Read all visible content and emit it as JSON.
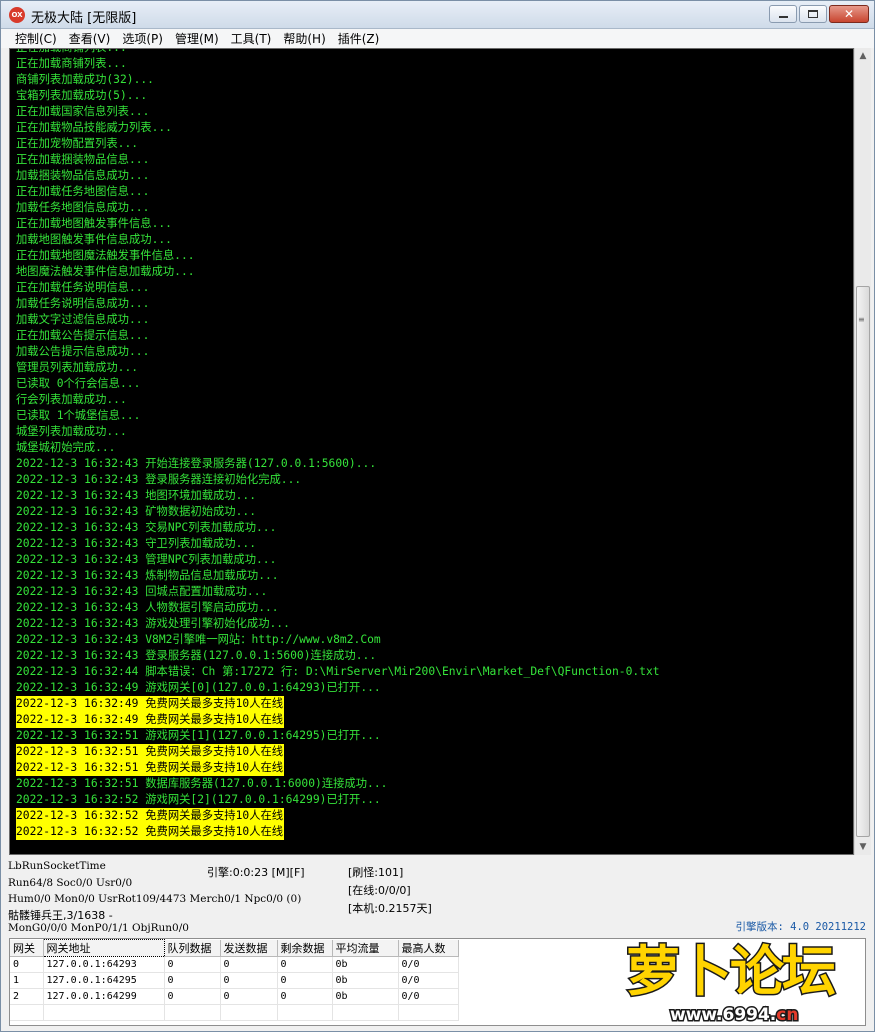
{
  "window": {
    "icon_text": "OX",
    "title": "无极大陆 [无限版]"
  },
  "menu": [
    "控制(C)",
    "查看(V)",
    "选项(P)",
    "管理(M)",
    "工具(T)",
    "帮助(H)",
    "插件(Z)"
  ],
  "colors": {
    "console_bg": "#000000",
    "log_text": "#35e33a",
    "highlight_bg": "#ffff00",
    "highlight_text": "#000000",
    "version_text": "#1b5aa6"
  },
  "log": [
    {
      "text": "正在加载商铺列表...",
      "highlight": false
    },
    {
      "text": "正在加载商铺列表...",
      "highlight": false
    },
    {
      "text": "商铺列表加载成功(32)...",
      "highlight": false
    },
    {
      "text": "宝箱列表加载成功(5)...",
      "highlight": false
    },
    {
      "text": "正在加载国家信息列表...",
      "highlight": false
    },
    {
      "text": "正在加载物品技能威力列表...",
      "highlight": false
    },
    {
      "text": "正在加宠物配置列表...",
      "highlight": false
    },
    {
      "text": "正在加载捆装物品信息...",
      "highlight": false
    },
    {
      "text": "加载捆装物品信息成功...",
      "highlight": false
    },
    {
      "text": "正在加载任务地图信息...",
      "highlight": false
    },
    {
      "text": "加载任务地图信息成功...",
      "highlight": false
    },
    {
      "text": "正在加载地图触发事件信息...",
      "highlight": false
    },
    {
      "text": "加载地图触发事件信息成功...",
      "highlight": false
    },
    {
      "text": "正在加载地图魔法触发事件信息...",
      "highlight": false
    },
    {
      "text": "地图魔法触发事件信息加载成功...",
      "highlight": false
    },
    {
      "text": "正在加载任务说明信息...",
      "highlight": false
    },
    {
      "text": "加载任务说明信息成功...",
      "highlight": false
    },
    {
      "text": "加载文字过滤信息成功...",
      "highlight": false
    },
    {
      "text": "正在加载公告提示信息...",
      "highlight": false
    },
    {
      "text": "加载公告提示信息成功...",
      "highlight": false
    },
    {
      "text": "管理员列表加载成功...",
      "highlight": false
    },
    {
      "text": "已读取 0个行会信息...",
      "highlight": false
    },
    {
      "text": "行会列表加载成功...",
      "highlight": false
    },
    {
      "text": "已读取 1个城堡信息...",
      "highlight": false
    },
    {
      "text": "城堡列表加载成功...",
      "highlight": false
    },
    {
      "text": "城堡城初始完成...",
      "highlight": false
    },
    {
      "text": "2022-12-3 16:32:43 开始连接登录服务器(127.0.0.1:5600)...",
      "highlight": false
    },
    {
      "text": "2022-12-3 16:32:43 登录服务器连接初始化完成...",
      "highlight": false
    },
    {
      "text": "2022-12-3 16:32:43 地图环境加载成功...",
      "highlight": false
    },
    {
      "text": "2022-12-3 16:32:43 矿物数据初始成功...",
      "highlight": false
    },
    {
      "text": "2022-12-3 16:32:43 交易NPC列表加载成功...",
      "highlight": false
    },
    {
      "text": "2022-12-3 16:32:43 守卫列表加载成功...",
      "highlight": false
    },
    {
      "text": "2022-12-3 16:32:43 管理NPC列表加载成功...",
      "highlight": false
    },
    {
      "text": "2022-12-3 16:32:43 炼制物品信息加载成功...",
      "highlight": false
    },
    {
      "text": "2022-12-3 16:32:43 回城点配置加载成功...",
      "highlight": false
    },
    {
      "text": "2022-12-3 16:32:43 人物数据引擎启动成功...",
      "highlight": false
    },
    {
      "text": "2022-12-3 16:32:43 游戏处理引擎初始化成功...",
      "highlight": false
    },
    {
      "text": "2022-12-3 16:32:43 V8M2引擎唯一网站：http://www.v8m2.Com",
      "highlight": false
    },
    {
      "text": "2022-12-3 16:32:43 登录服务器(127.0.0.1:5600)连接成功...",
      "highlight": false
    },
    {
      "text": "2022-12-3 16:32:44 脚本错误：Ch 第:17272 行: D:\\MirServer\\Mir200\\Envir\\Market_Def\\QFunction-0.txt",
      "highlight": false
    },
    {
      "text": "2022-12-3 16:32:49 游戏网关[0](127.0.0.1:64293)已打开...",
      "highlight": false
    },
    {
      "text": "2022-12-3 16:32:49 免费网关最多支持10人在线",
      "highlight": true
    },
    {
      "text": "2022-12-3 16:32:49 免费网关最多支持10人在线",
      "highlight": true
    },
    {
      "text": "2022-12-3 16:32:51 游戏网关[1](127.0.0.1:64295)已打开...",
      "highlight": false
    },
    {
      "text": "2022-12-3 16:32:51 免费网关最多支持10人在线",
      "highlight": true
    },
    {
      "text": "2022-12-3 16:32:51 免费网关最多支持10人在线",
      "highlight": true
    },
    {
      "text": "2022-12-3 16:32:51 数据库服务器(127.0.0.1:6000)连接成功...",
      "highlight": false
    },
    {
      "text": "2022-12-3 16:32:52 游戏网关[2](127.0.0.1:64299)已打开...",
      "highlight": false
    },
    {
      "text": "2022-12-3 16:32:52 免费网关最多支持10人在线",
      "highlight": true
    },
    {
      "text": "2022-12-3 16:32:52 免费网关最多支持10人在线",
      "highlight": true
    }
  ],
  "status": {
    "socket_time": "LbRunSocketTime",
    "run": "Run64/8 Soc0/0 Usr0/0",
    "hum": "Hum0/0 Mon0/0 UsrRot109/4473 Merch0/1 Npc0/0 (0)",
    "boss": "骷髅锤兵王,3/1638 -",
    "mon": "MonG0/0/0 MonP0/1/1 ObjRun0/0",
    "engine_time": "引擎:0:0:23 [M][F]",
    "refresh_monster": "[刷怪:101]",
    "online": "[在线:0/0/0]",
    "uptime": "[本机:0.2157天]",
    "version": "引擎版本: 4.0 20211212"
  },
  "gateway_table": {
    "headers": [
      "网关",
      "网关地址",
      "队列数据",
      "发送数据",
      "剩余数据",
      "平均流量",
      "最高人数"
    ],
    "rows": [
      [
        "0",
        "127.0.0.1:64293",
        "0",
        "0",
        "0",
        "0b",
        "0/0"
      ],
      [
        "1",
        "127.0.0.1:64295",
        "0",
        "0",
        "0",
        "0b",
        "0/0"
      ],
      [
        "2",
        "127.0.0.1:64299",
        "0",
        "0",
        "0",
        "0b",
        "0/0"
      ]
    ]
  },
  "watermark": {
    "logo_text": "萝卜论坛",
    "url_prefix": "www.6994.",
    "url_suffix": "cn"
  }
}
